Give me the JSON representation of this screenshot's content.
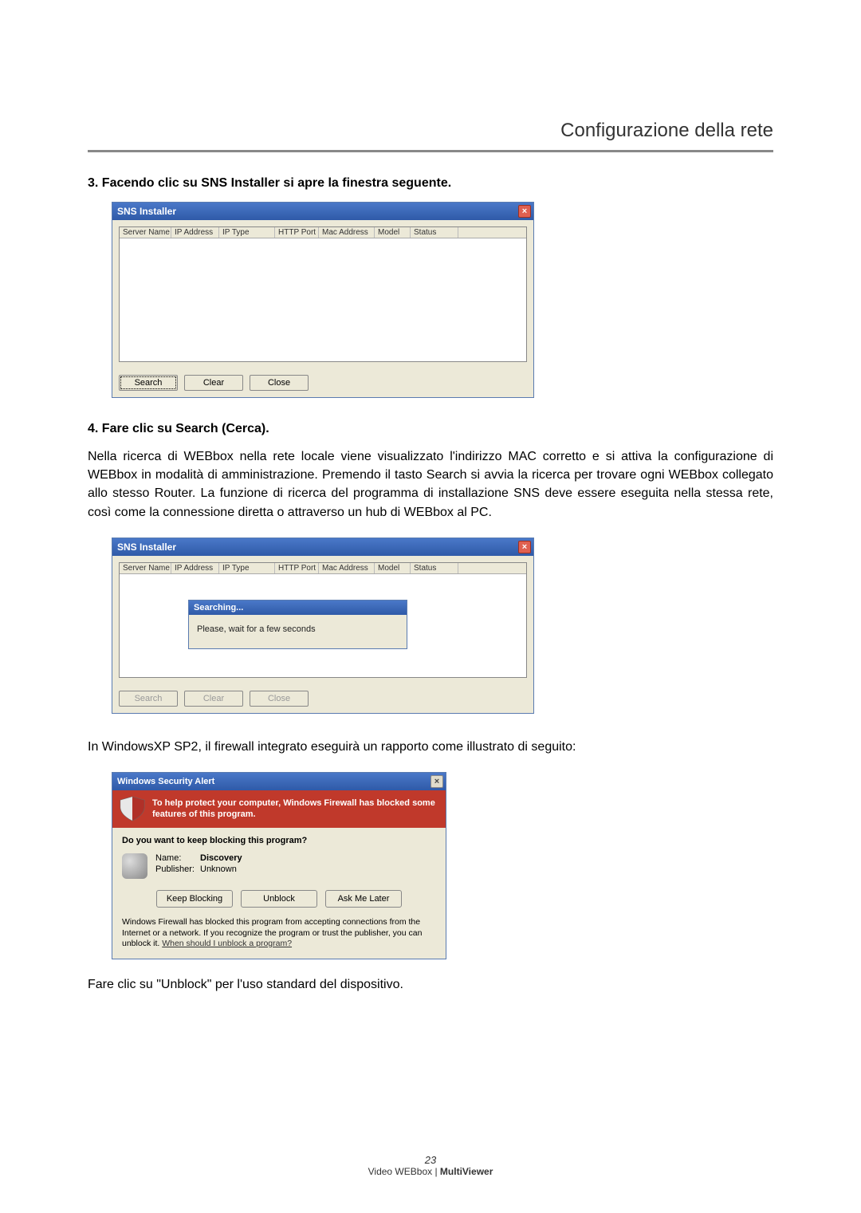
{
  "header": {
    "title": "Configurazione della rete"
  },
  "step3": {
    "heading": "3. Facendo clic su SNS Installer si apre la finestra seguente."
  },
  "sns": {
    "title": "SNS Installer",
    "columns": {
      "server": "Server Name",
      "ip": "IP Address",
      "iptype": "IP Type",
      "http": "HTTP Port",
      "mac": "Mac Address",
      "model": "Model",
      "status": "Status"
    },
    "buttons": {
      "search": "Search",
      "clear": "Clear",
      "close": "Close"
    },
    "searching": {
      "title": "Searching...",
      "msg": "Please, wait for a few seconds"
    }
  },
  "step4": {
    "heading": "4. Fare clic su Search (Cerca).",
    "para": "Nella ricerca di  WEBbox nella rete locale viene visualizzato l'indirizzo MAC corretto e si attiva la configurazione di WEBbox in modalità di amministrazione. Premendo il tasto Search si avvia la ricerca per trovare ogni WEBbox collegato allo stesso Router. La funzione di ricerca del programma di installazione SNS deve essere eseguita nella stessa rete, così come la connessione diretta o attraverso un hub di WEBbox al PC."
  },
  "xp_note": "In WindowsXP SP2, il firewall integrato eseguirà un rapporto come illustrato di seguito:",
  "alert": {
    "title": "Windows Security Alert",
    "banner": "To help protect your computer,  Windows Firewall has blocked some features of this program.",
    "question": "Do you want to keep blocking this program?",
    "name_label": "Name:",
    "name_value": "Discovery",
    "pub_label": "Publisher:",
    "pub_value": "Unknown",
    "buttons": {
      "keep": "Keep Blocking",
      "unblock": "Unblock",
      "ask": "Ask Me Later"
    },
    "explain_pre": "Windows Firewall has blocked this program from accepting connections from the Internet or a network. If you recognize the program or trust the publisher, you can unblock it. ",
    "explain_link": "When should I unblock a program?"
  },
  "unblock_note": "Fare clic su \"Unblock\" per l'uso standard del dispositivo.",
  "footer": {
    "page": "23",
    "product_a": "Video WEBbox | ",
    "product_b": "MultiViewer"
  }
}
